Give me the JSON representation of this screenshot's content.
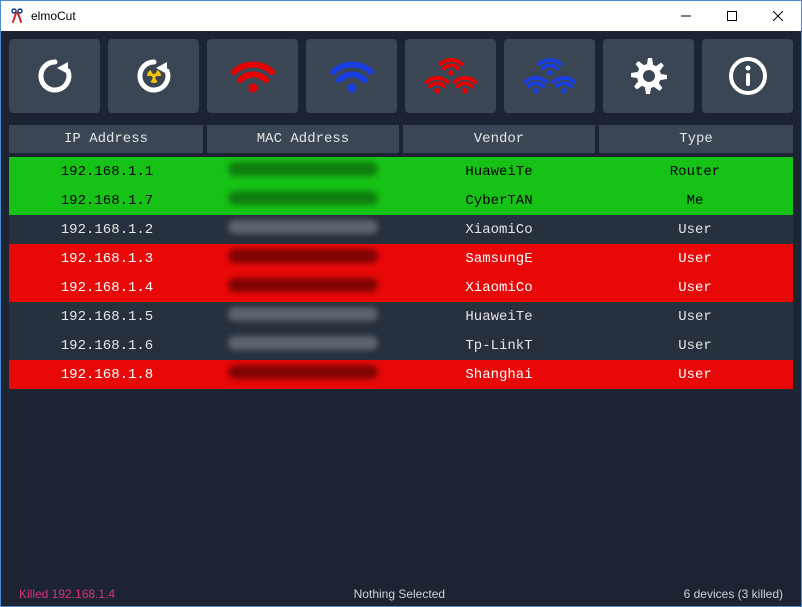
{
  "window": {
    "title": "elmoCut"
  },
  "toolbar": {
    "buttons": [
      "refresh",
      "scan",
      "cut-one",
      "uncut-one",
      "cut-all",
      "uncut-all",
      "settings",
      "about"
    ]
  },
  "table": {
    "headers": {
      "ip": "IP Address",
      "mac": "MAC Address",
      "vendor": "Vendor",
      "type": "Type"
    },
    "rows": [
      {
        "ip": "192.168.1.1",
        "vendor": "HuaweiTe",
        "type": "Router",
        "state": "green"
      },
      {
        "ip": "192.168.1.7",
        "vendor": "CyberTAN",
        "type": "Me",
        "state": "green"
      },
      {
        "ip": "192.168.1.2",
        "vendor": "XiaomiCo",
        "type": "User",
        "state": "dark"
      },
      {
        "ip": "192.168.1.3",
        "vendor": "SamsungE",
        "type": "User",
        "state": "red"
      },
      {
        "ip": "192.168.1.4",
        "vendor": "XiaomiCo",
        "type": "User",
        "state": "red"
      },
      {
        "ip": "192.168.1.5",
        "vendor": "HuaweiTe",
        "type": "User",
        "state": "dark"
      },
      {
        "ip": "192.168.1.6",
        "vendor": "Tp-LinkT",
        "type": "User",
        "state": "dark"
      },
      {
        "ip": "192.168.1.8",
        "vendor": "Shanghai",
        "type": "User",
        "state": "red"
      }
    ]
  },
  "status": {
    "left": "Killed 192.168.1.4",
    "center": "Nothing Selected",
    "right": "6 devices (3 killed)"
  }
}
